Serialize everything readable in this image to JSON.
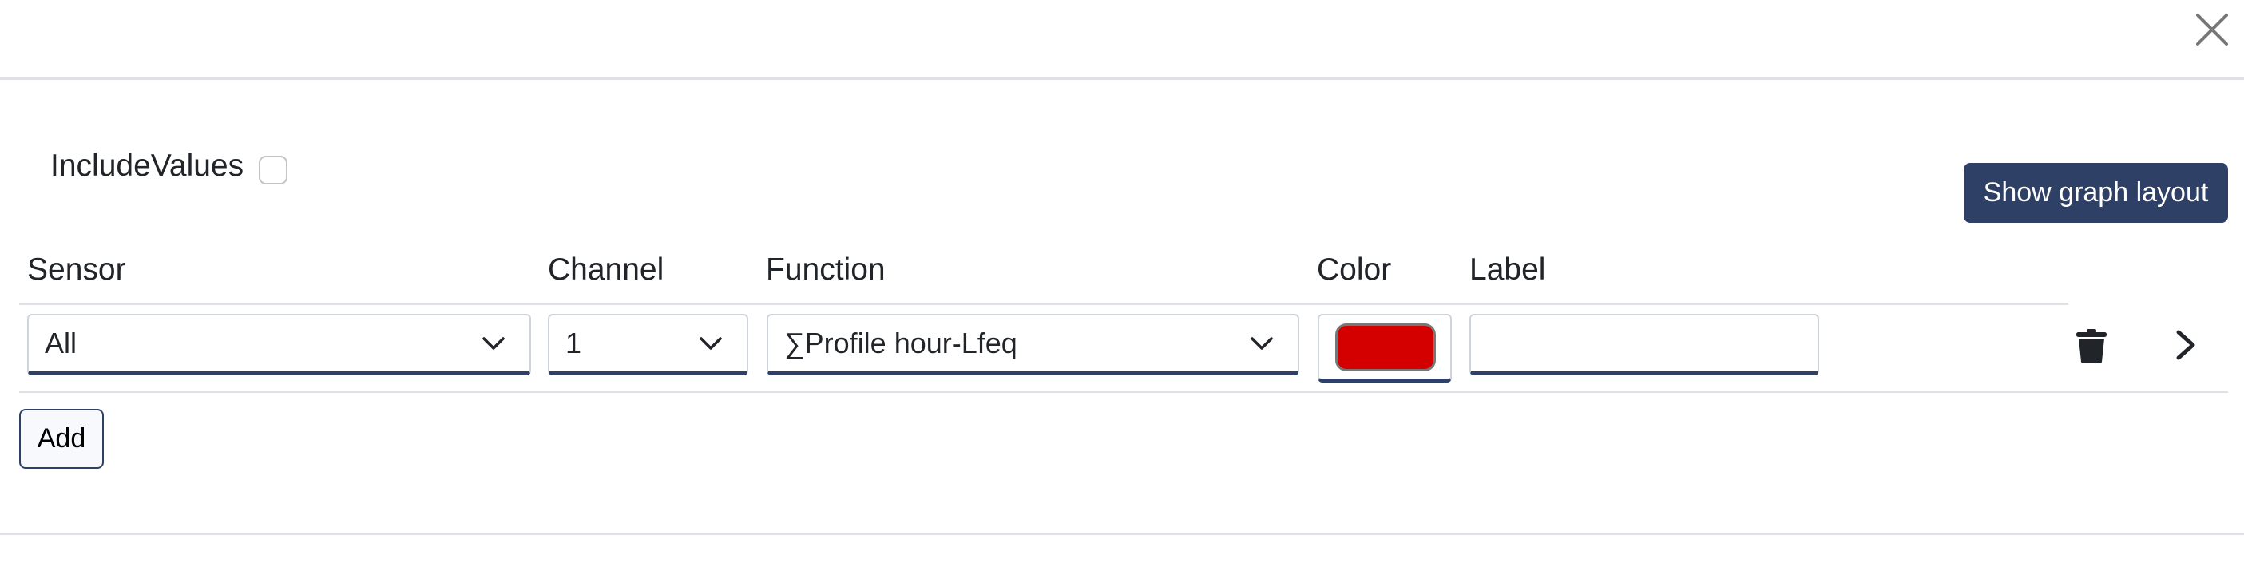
{
  "dialog": {
    "close_icon": "close-icon"
  },
  "options": {
    "include_values_label": "IncludeValues",
    "include_values_checked": false,
    "show_graph_layout_label": "Show graph layout"
  },
  "table": {
    "headers": {
      "sensor": "Sensor",
      "channel": "Channel",
      "function": "Function",
      "color": "Color",
      "label": "Label"
    },
    "rows": [
      {
        "sensor": "All",
        "channel": "1",
        "function": "∑Profile hour-Lfeq",
        "color": "#d40000",
        "label": "",
        "delete_icon": "trash-icon",
        "expand_icon": "chevron-right-icon"
      }
    ]
  },
  "actions": {
    "add_label": "Add"
  },
  "colors": {
    "primary": "#2e4066",
    "divider": "#dee2e6"
  }
}
